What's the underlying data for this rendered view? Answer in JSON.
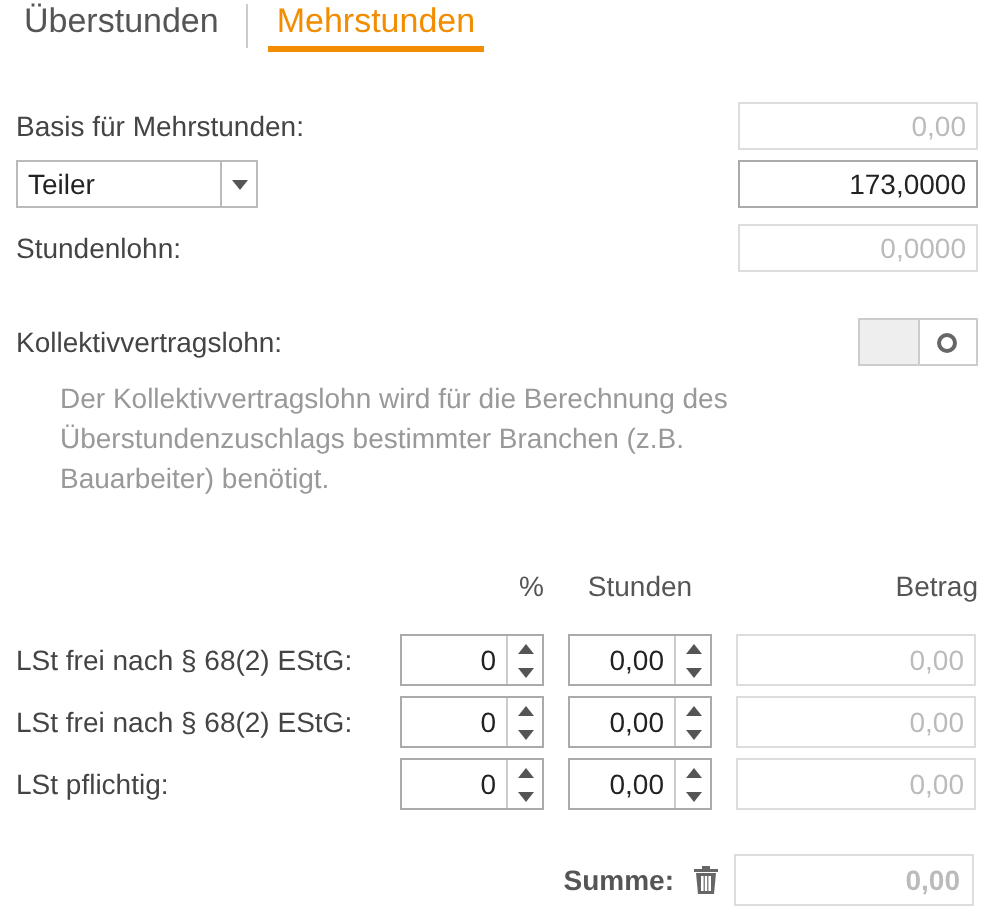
{
  "tabs": [
    {
      "label": "Überstunden",
      "selected": false
    },
    {
      "label": "Mehrstunden",
      "selected": true
    }
  ],
  "basis": {
    "label": "Basis für Mehrstunden:",
    "value": "0,00",
    "disabled": true
  },
  "divisor": {
    "select": "Teiler",
    "value": "173,0000",
    "disabled": false
  },
  "hourly_wage": {
    "label": "Stundenlohn:",
    "value": "0,0000",
    "disabled": true
  },
  "collective_wage": {
    "label": "Kollektivvertragslohn:",
    "on": false,
    "description": "Der Kollektivvertragslohn wird für die Berechnung des Überstundenzuschlags bestimmter Branchen (z.B. Bauarbeiter) benötigt."
  },
  "columns": [
    "%",
    "Stunden",
    "Betrag"
  ],
  "rows": [
    {
      "label": "LSt frei nach § 68(2) EStG:",
      "percent": "0",
      "hours": "0,00",
      "amount": "0,00"
    },
    {
      "label": "LSt frei nach § 68(2) EStG:",
      "percent": "0",
      "hours": "0,00",
      "amount": "0,00"
    },
    {
      "label": "LSt pflichtig:",
      "percent": "0",
      "hours": "0,00",
      "amount": "0,00"
    }
  ],
  "sum": {
    "label": "Summe:",
    "value": "0,00"
  }
}
